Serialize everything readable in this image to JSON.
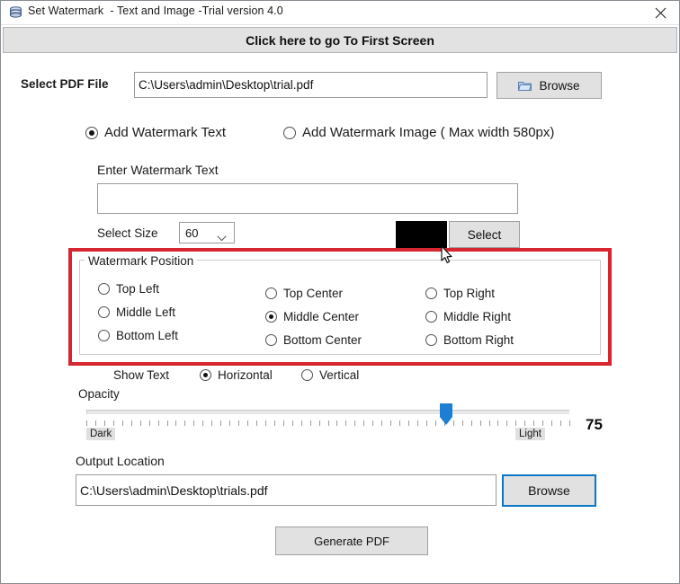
{
  "window": {
    "title": "Set Watermark  - Text and Image -Trial version 4.0",
    "app_icon": "database-stack-icon",
    "close_label": "✕"
  },
  "banner": {
    "label": "Click here to go To First Screen"
  },
  "source": {
    "label": "Select PDF File",
    "path_value": "C:\\Users\\admin\\Desktop\\trial.pdf",
    "browse_label": "Browse"
  },
  "mode": {
    "options": [
      {
        "label": "Add Watermark Text",
        "selected": true
      },
      {
        "label": "Add Watermark Image ( Max width 580px)",
        "selected": false
      }
    ]
  },
  "watermark_text": {
    "label": "Enter Watermark Text",
    "value": ""
  },
  "size": {
    "label": "Select Size",
    "value": "60"
  },
  "color": {
    "swatch_hex": "#000000",
    "select_label": "Select"
  },
  "position": {
    "legend": "Watermark Position",
    "options": [
      {
        "label": "Top Left",
        "selected": false
      },
      {
        "label": "Middle Left",
        "selected": false
      },
      {
        "label": "Bottom Left",
        "selected": false
      },
      {
        "label": "Top Center",
        "selected": false
      },
      {
        "label": "Middle Center",
        "selected": true
      },
      {
        "label": "Bottom Center",
        "selected": false
      },
      {
        "label": "Top Right",
        "selected": false
      },
      {
        "label": "Middle Right",
        "selected": false
      },
      {
        "label": "Bottom Right",
        "selected": false
      }
    ]
  },
  "orientation": {
    "label": "Show Text",
    "options": [
      {
        "label": "Horizontal",
        "selected": true
      },
      {
        "label": "Vertical",
        "selected": false
      }
    ]
  },
  "opacity": {
    "label": "Opacity",
    "min_label": "Dark",
    "max_label": "Light",
    "value": "75"
  },
  "output": {
    "label": "Output Location",
    "path_value": "C:\\Users\\admin\\Desktop\\trials.pdf",
    "browse_label": "Browse"
  },
  "generate": {
    "label": "Generate PDF"
  },
  "colors": {
    "highlight_red": "#d7262f",
    "focus_blue": "#0a76c8",
    "slider_blue": "#1c7fd4"
  }
}
